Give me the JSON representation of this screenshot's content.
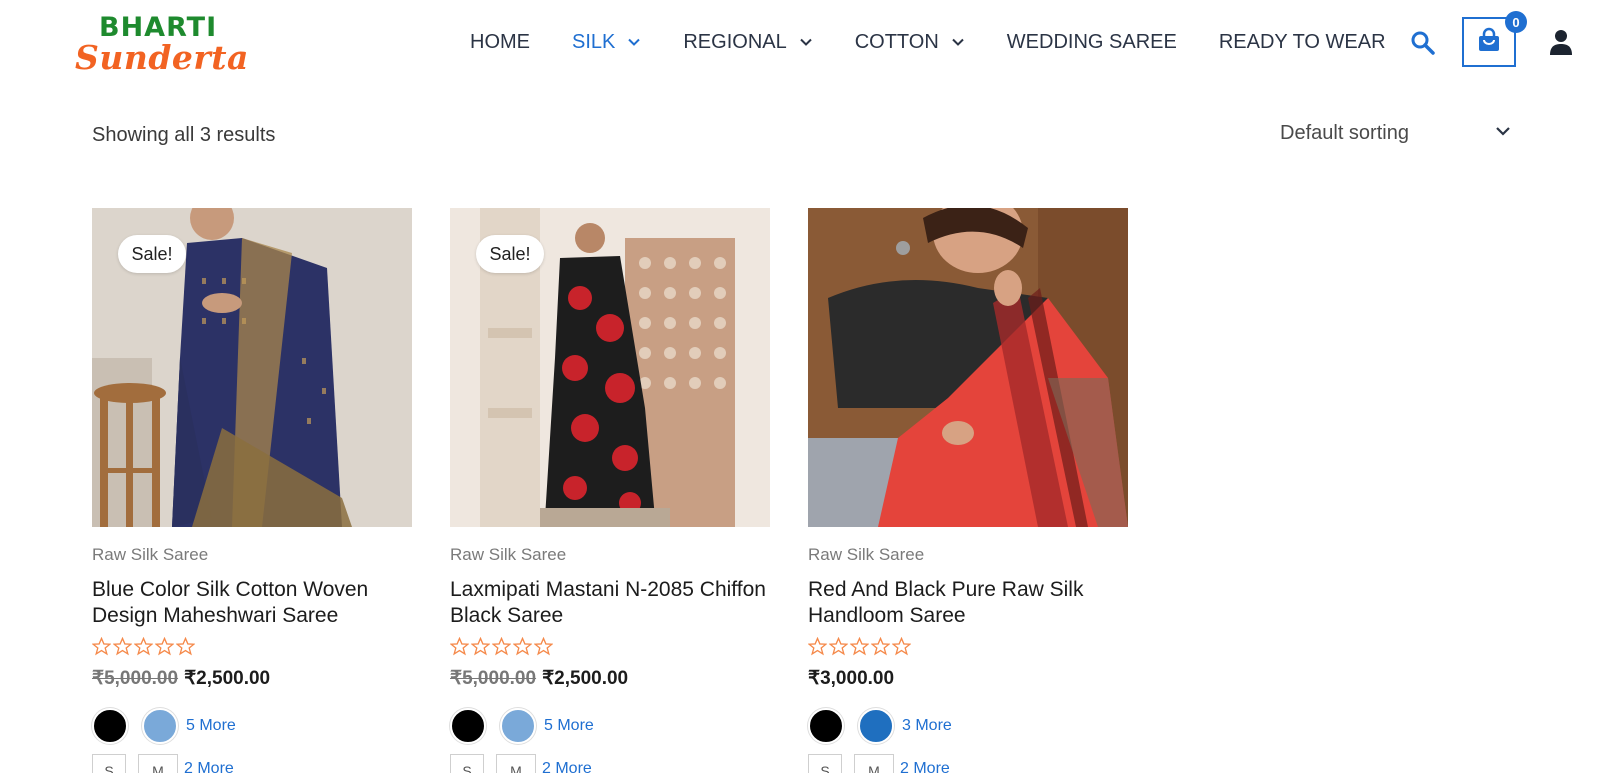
{
  "header": {
    "logo": {
      "line1": "BHARTI",
      "line2": "Sunderta"
    },
    "nav": [
      {
        "label": "HOME",
        "has_dropdown": false,
        "active": false
      },
      {
        "label": "SILK",
        "has_dropdown": true,
        "active": true
      },
      {
        "label": "REGIONAL",
        "has_dropdown": true,
        "active": false
      },
      {
        "label": "COTTON",
        "has_dropdown": true,
        "active": false
      },
      {
        "label": "WEDDING SAREE",
        "has_dropdown": false,
        "active": false
      },
      {
        "label": "READY TO WEAR",
        "has_dropdown": false,
        "active": false
      }
    ],
    "cart_count": "0",
    "icons": [
      "search-icon",
      "shopping-bag-icon",
      "user-icon"
    ]
  },
  "toolbar": {
    "results_text": "Showing all 3 results",
    "sort_selected": "Default sorting"
  },
  "colors": {
    "accent": "#1f6fd1",
    "logo_green": "#1e8a2e",
    "logo_orange": "#f26322",
    "star": "#f5894a"
  },
  "products": [
    {
      "badge": "Sale!",
      "category": "Raw Silk Saree",
      "title": "Blue Color Silk Cotton Woven Design Maheshwari Saree",
      "rating": 0,
      "old_price": "₹5,000.00",
      "price": "₹2,500.00",
      "swatch_colors": [
        "#000000",
        "#7aa9d9"
      ],
      "swatch_more": "5 More",
      "sizes": [
        "S",
        "M"
      ],
      "sizes_more": "2 More"
    },
    {
      "badge": "Sale!",
      "category": "Raw Silk Saree",
      "title": "Laxmipati Mastani N-2085 Chiffon Black Saree",
      "rating": 0,
      "old_price": "₹5,000.00",
      "price": "₹2,500.00",
      "swatch_colors": [
        "#000000",
        "#7aa9d9"
      ],
      "swatch_more": "5 More",
      "sizes": [
        "S",
        "M"
      ],
      "sizes_more": "2 More"
    },
    {
      "badge": "",
      "category": "Raw Silk Saree",
      "title": "Red And Black Pure Raw Silk Handloom Saree",
      "rating": 0,
      "old_price": "",
      "price": "₹3,000.00",
      "swatch_colors": [
        "#000000",
        "#1f6fbf"
      ],
      "swatch_more": "3 More",
      "sizes": [
        "S",
        "M"
      ],
      "sizes_more": "2 More"
    }
  ]
}
